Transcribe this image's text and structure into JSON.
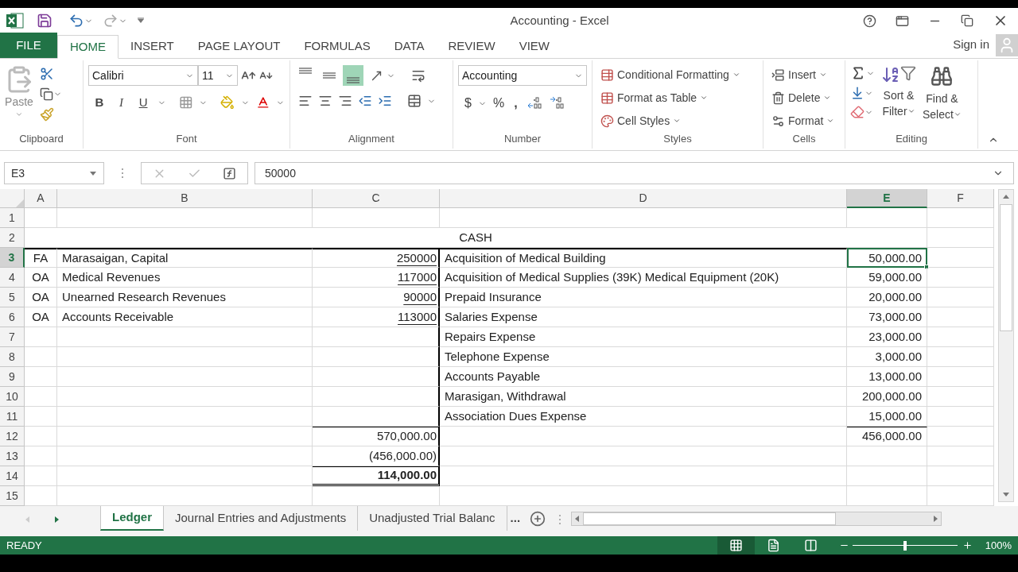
{
  "window": {
    "title": "Accounting - Excel"
  },
  "ribbon_tabs": [
    {
      "label": "FILE",
      "kind": "file",
      "selected": false
    },
    {
      "label": "HOME",
      "kind": "tab",
      "selected": true
    },
    {
      "label": "INSERT",
      "kind": "tab",
      "selected": false
    },
    {
      "label": "PAGE LAYOUT",
      "kind": "tab",
      "selected": false
    },
    {
      "label": "FORMULAS",
      "kind": "tab",
      "selected": false
    },
    {
      "label": "DATA",
      "kind": "tab",
      "selected": false
    },
    {
      "label": "REVIEW",
      "kind": "tab",
      "selected": false
    },
    {
      "label": "VIEW",
      "kind": "tab",
      "selected": false
    }
  ],
  "account": {
    "label": "Sign in"
  },
  "ribbon": {
    "clipboard": {
      "paste": "Paste",
      "group": "Clipboard"
    },
    "font": {
      "name": "Calibri",
      "size": "11",
      "bold": "B",
      "italic": "I",
      "underline": "U",
      "group": "Font"
    },
    "alignment": {
      "vertical": [
        {
          "selected": false
        },
        {
          "selected": false
        },
        {
          "selected": true
        }
      ],
      "group": "Alignment"
    },
    "number": {
      "format": "Accounting",
      "currency": "$",
      "percent": "%",
      "comma": ",",
      "group": "Number"
    },
    "styles": {
      "items": [
        "Conditional Formatting",
        "Format as Table",
        "Cell Styles"
      ],
      "group": "Styles"
    },
    "cells": {
      "items": [
        "Insert",
        "Delete",
        "Format"
      ],
      "group": "Cells"
    },
    "editing": {
      "sort": [
        "Sort &",
        "Filter"
      ],
      "find": [
        "Find &",
        "Select"
      ],
      "group": "Editing"
    }
  },
  "formula_bar": {
    "name_box": "E3",
    "formula": "50000"
  },
  "sheet": {
    "columns": [
      {
        "label": "A",
        "selected": false
      },
      {
        "label": "B",
        "selected": false
      },
      {
        "label": "C",
        "selected": false
      },
      {
        "label": "D",
        "selected": false
      },
      {
        "label": "E",
        "selected": true
      },
      {
        "label": "F",
        "selected": false
      }
    ],
    "rows": [
      {
        "header": "1",
        "selected": false
      },
      {
        "header": "2",
        "selected": false,
        "title": "CASH"
      },
      {
        "header": "3",
        "selected": true,
        "a": "FA",
        "b": "Marasaigan, Capital",
        "c": {
          "text": "250000",
          "underlined": true,
          "bold": false,
          "top_border": false,
          "double_bottom": false
        },
        "d": "Acquisition of Medical Building",
        "e": {
          "text": "50,000.00",
          "selected": true,
          "top_border": false
        }
      },
      {
        "header": "4",
        "selected": false,
        "a": "OA",
        "b": "Medical Revenues",
        "c": {
          "text": "117000",
          "underlined": true,
          "bold": false,
          "top_border": false,
          "double_bottom": false
        },
        "d": "Acquisition of Medical Supplies (39K) Medical Equipment (20K)",
        "e": {
          "text": "59,000.00",
          "selected": false,
          "top_border": false
        }
      },
      {
        "header": "5",
        "selected": false,
        "a": "OA",
        "b": "Unearned Research Revenues",
        "c": {
          "text": "90000",
          "underlined": true,
          "bold": false,
          "top_border": false,
          "double_bottom": false
        },
        "d": "Prepaid Insurance",
        "e": {
          "text": "20,000.00",
          "selected": false,
          "top_border": false
        }
      },
      {
        "header": "6",
        "selected": false,
        "a": "OA",
        "b": "Accounts Receivable",
        "c": {
          "text": "113000",
          "underlined": true,
          "bold": false,
          "top_border": false,
          "double_bottom": false
        },
        "d": "Salaries Expense",
        "e": {
          "text": "73,000.00",
          "selected": false,
          "top_border": false
        }
      },
      {
        "header": "7",
        "selected": false,
        "d": "Repairs Expense",
        "e": {
          "text": "23,000.00",
          "selected": false,
          "top_border": false
        }
      },
      {
        "header": "8",
        "selected": false,
        "d": "Telephone Expense",
        "e": {
          "text": "3,000.00",
          "selected": false,
          "top_border": false
        }
      },
      {
        "header": "9",
        "selected": false,
        "d": "Accounts Payable",
        "e": {
          "text": "13,000.00",
          "selected": false,
          "top_border": false
        }
      },
      {
        "header": "10",
        "selected": false,
        "d": "Marasigan, Withdrawal",
        "e": {
          "text": "200,000.00",
          "selected": false,
          "top_border": false
        }
      },
      {
        "header": "11",
        "selected": false,
        "d": "Association Dues Expense",
        "e": {
          "text": "15,000.00",
          "selected": false,
          "top_border": false
        }
      },
      {
        "header": "12",
        "selected": false,
        "c": {
          "text": "570,000.00",
          "underlined": false,
          "bold": false,
          "top_border": true,
          "double_bottom": false
        },
        "e": {
          "text": "456,000.00",
          "selected": false,
          "top_border": true
        }
      },
      {
        "header": "13",
        "selected": false,
        "c": {
          "text": "(456,000.00)",
          "underlined": false,
          "bold": false,
          "top_border": false,
          "double_bottom": false
        }
      },
      {
        "header": "14",
        "selected": false,
        "c": {
          "text": "114,000.00",
          "underlined": false,
          "bold": true,
          "top_border": true,
          "double_bottom": true
        }
      },
      {
        "header": "15",
        "selected": false
      }
    ]
  },
  "sheet_tabs": {
    "tabs": [
      {
        "label": "Ledger",
        "selected": true
      },
      {
        "label": "Journal Entries and Adjustments",
        "selected": false
      },
      {
        "label": "Unadjusted Trial Balanc",
        "selected": false
      }
    ],
    "more": "..."
  },
  "status_bar": {
    "mode": "READY",
    "views": [
      {
        "kind": "normal",
        "selected": true
      },
      {
        "kind": "page_layout",
        "selected": false
      },
      {
        "kind": "page_break",
        "selected": false
      }
    ],
    "zoom": {
      "level": 0.5
    },
    "zoom_label": "100%"
  }
}
